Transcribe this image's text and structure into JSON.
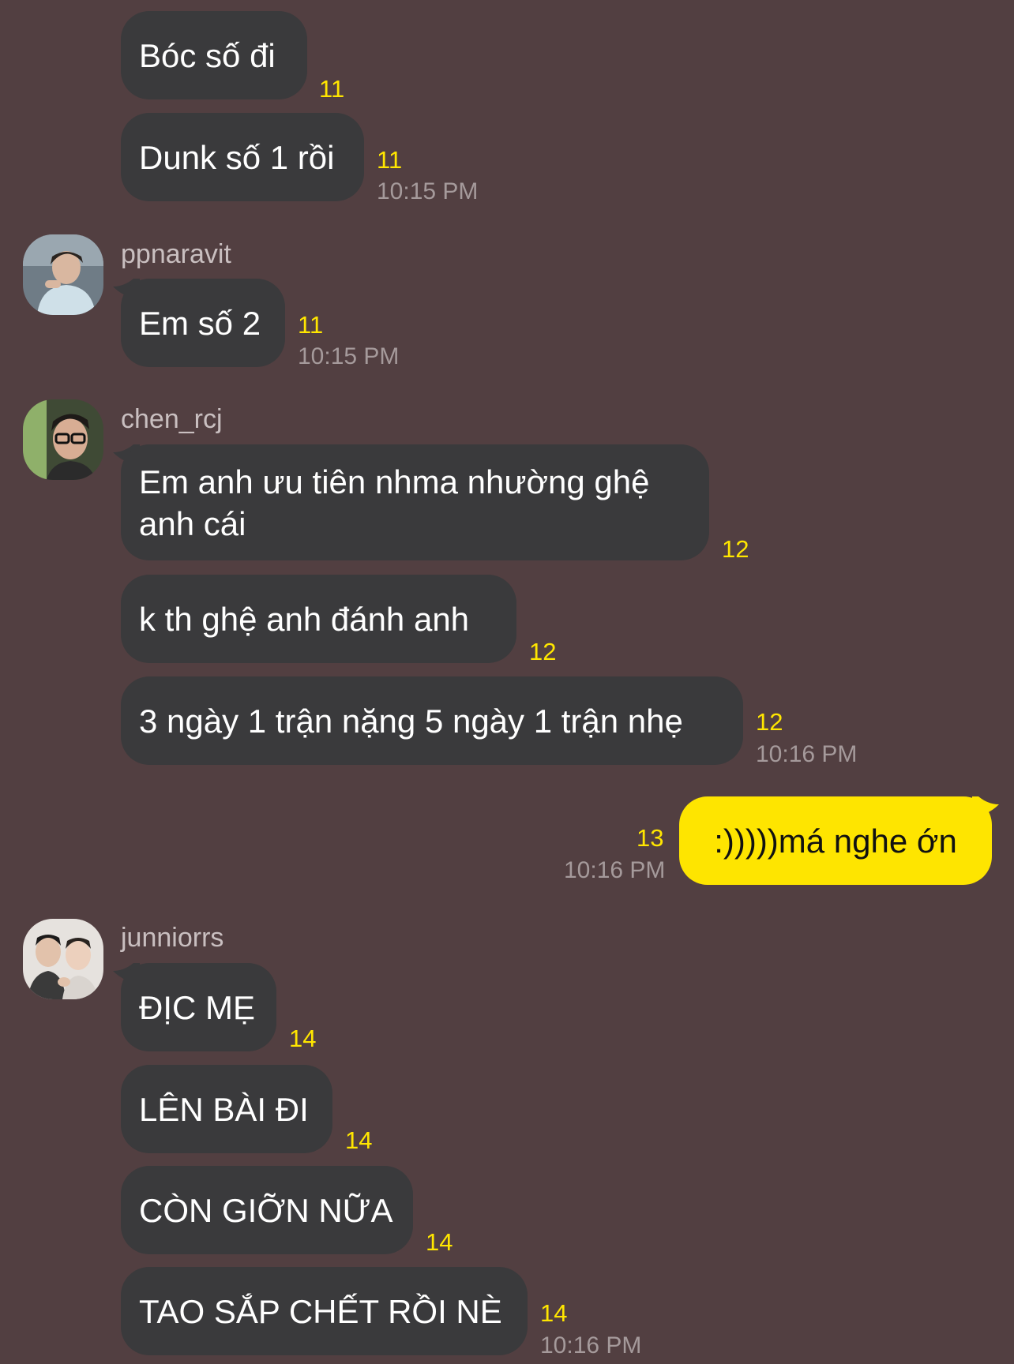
{
  "colors": {
    "background": "#523f41",
    "incoming_bubble": "#3a3a3c",
    "outgoing_bubble": "#fee500",
    "unread_count": "#ffe600",
    "timestamp": "#a59a9b"
  },
  "messages": [
    {
      "text": "Bóc số đi",
      "count": "11"
    },
    {
      "text": "Dunk số 1 rồi",
      "count": "11",
      "time": "10:15 PM"
    },
    {
      "sender": "ppnaravit",
      "text": "Em số 2",
      "count": "11",
      "time": "10:15 PM"
    },
    {
      "sender": "chen_rcj",
      "text": "Em anh ưu tiên nhma nhường ghệ anh cái",
      "count": "12"
    },
    {
      "text": "k th ghệ anh đánh anh",
      "count": "12"
    },
    {
      "text": "3 ngày 1 trận nặng 5 ngày 1 trận nhẹ",
      "count": "12",
      "time": "10:16 PM"
    },
    {
      "mine": true,
      "text": ":)))))má nghe ớn",
      "count": "13",
      "time": "10:16 PM"
    },
    {
      "sender": "junniorrs",
      "text": "ĐỊC MẸ",
      "count": "14"
    },
    {
      "text": "LÊN BÀI ĐI",
      "count": "14"
    },
    {
      "text": "CÒN GIỠN NỮA",
      "count": "14"
    },
    {
      "text": "TAO SẮP CHẾT RỒI NÈ",
      "count": "14",
      "time": "10:16 PM"
    }
  ]
}
